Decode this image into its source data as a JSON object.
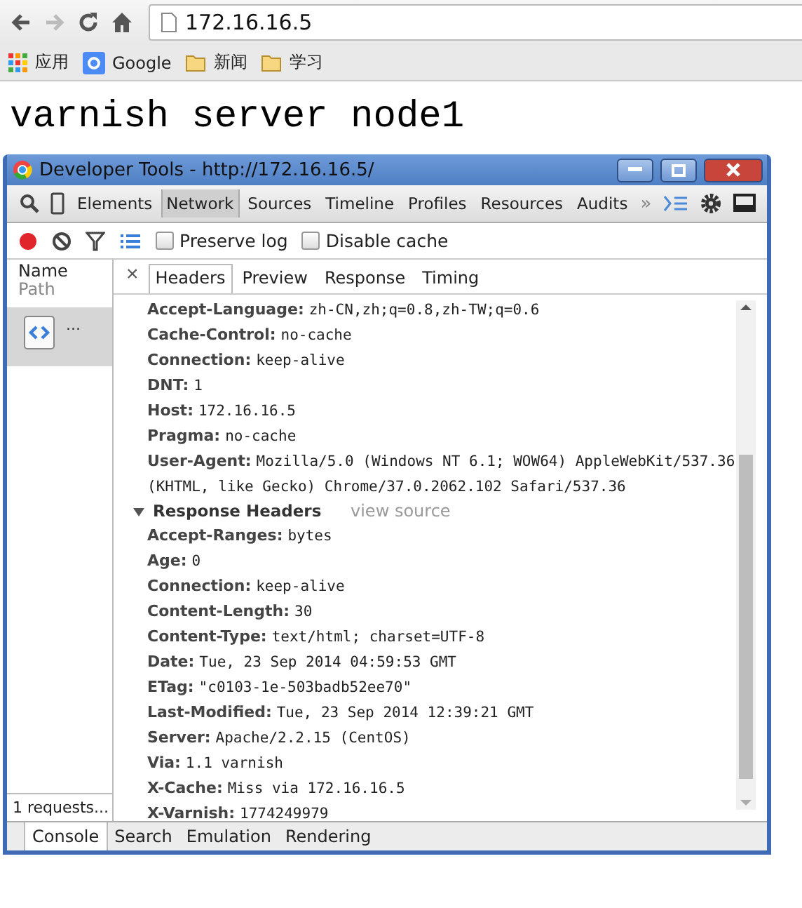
{
  "browser": {
    "address": "172.16.16.5",
    "forward_disabled": true
  },
  "bookmarks": [
    {
      "kind": "apps",
      "label": "应用"
    },
    {
      "kind": "google",
      "label": "Google"
    },
    {
      "kind": "folder",
      "label": "新闻"
    },
    {
      "kind": "folder",
      "label": "学习"
    }
  ],
  "page_heading": "varnish server node1",
  "devtools": {
    "title": "Developer Tools - http://172.16.16.5/",
    "panels": [
      {
        "label": "Elements",
        "selected": false
      },
      {
        "label": "Network",
        "selected": true
      },
      {
        "label": "Sources",
        "selected": false
      },
      {
        "label": "Timeline",
        "selected": false
      },
      {
        "label": "Profiles",
        "selected": false
      },
      {
        "label": "Resources",
        "selected": false
      },
      {
        "label": "Audits",
        "selected": false
      }
    ],
    "overflow": "»",
    "network_toolbar": {
      "recording": true,
      "preserve_log": {
        "label": "Preserve log",
        "checked": false
      },
      "disable_cache": {
        "label": "Disable cache",
        "checked": false
      }
    },
    "requests": {
      "name_header": "Name",
      "path_header": "Path",
      "items": [
        {
          "name": "...",
          "selected": true
        }
      ],
      "status": "1 requests..."
    },
    "detail_close": "×",
    "detail_tabs": [
      {
        "label": "Headers",
        "selected": true
      },
      {
        "label": "Preview",
        "selected": false
      },
      {
        "label": "Response",
        "selected": false
      },
      {
        "label": "Timing",
        "selected": false
      }
    ],
    "request_headers": [
      {
        "name": "Accept-Language:",
        "value": "zh-CN,zh;q=0.8,zh-TW;q=0.6"
      },
      {
        "name": "Cache-Control:",
        "value": "no-cache"
      },
      {
        "name": "Connection:",
        "value": "keep-alive"
      },
      {
        "name": "DNT:",
        "value": "1"
      },
      {
        "name": "Host:",
        "value": "172.16.16.5"
      },
      {
        "name": "Pragma:",
        "value": "no-cache"
      },
      {
        "name": "User-Agent:",
        "value": "Mozilla/5.0 (Windows NT 6.1; WOW64) AppleWebKit/537.36 (KHTML, like Gecko) Chrome/37.0.2062.102 Safari/537.36"
      }
    ],
    "response_section": {
      "title": "Response Headers",
      "expanded": true,
      "link": "view source"
    },
    "response_headers": [
      {
        "name": "Accept-Ranges:",
        "value": "bytes"
      },
      {
        "name": "Age:",
        "value": "0"
      },
      {
        "name": "Connection:",
        "value": "keep-alive"
      },
      {
        "name": "Content-Length:",
        "value": "30"
      },
      {
        "name": "Content-Type:",
        "value": "text/html; charset=UTF-8"
      },
      {
        "name": "Date:",
        "value": "Tue, 23 Sep 2014 04:59:53 GMT"
      },
      {
        "name": "ETag:",
        "value": "\"c0103-1e-503badb52ee70\""
      },
      {
        "name": "Last-Modified:",
        "value": "Tue, 23 Sep 2014 12:39:21 GMT"
      },
      {
        "name": "Server:",
        "value": "Apache/2.2.15 (CentOS)"
      },
      {
        "name": "Via:",
        "value": "1.1 varnish"
      },
      {
        "name": "X-Cache:",
        "value": "Miss via 172.16.16.5"
      },
      {
        "name": "X-Varnish:",
        "value": "1774249979"
      }
    ],
    "drawer_tabs": [
      {
        "label": "Console",
        "selected": true
      },
      {
        "label": "Search",
        "selected": false
      },
      {
        "label": "Emulation",
        "selected": false
      },
      {
        "label": "Rendering",
        "selected": false
      }
    ]
  }
}
